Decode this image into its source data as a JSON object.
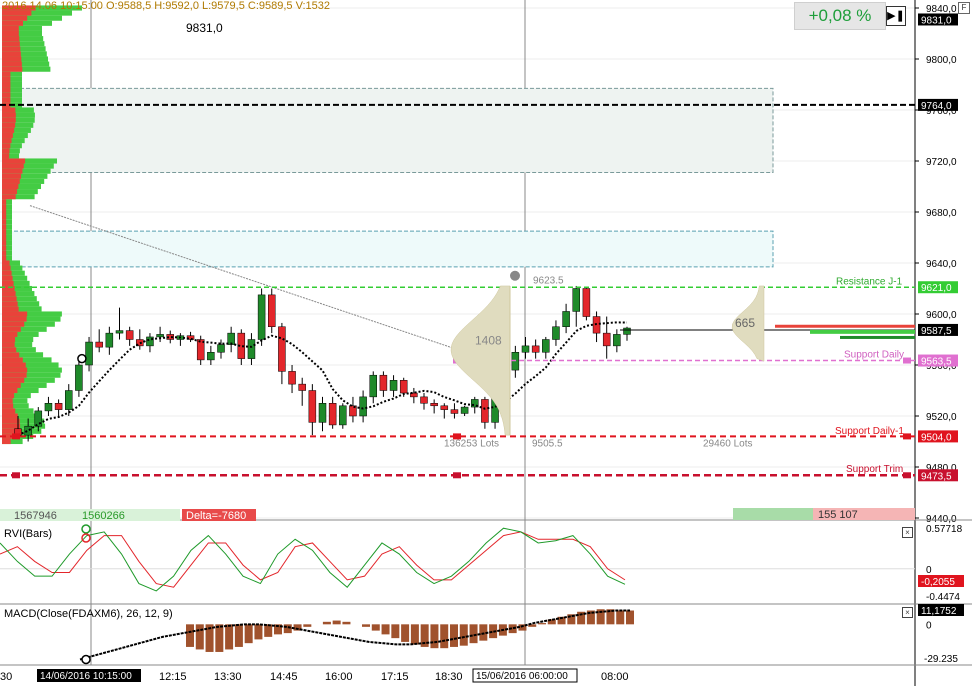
{
  "header": {
    "ohlc": "2016.14.06 10:15:00  O:9588,5  H:9592,0  L:9579,5  C:9589,5  V:1532",
    "change_pct": "+0,08 %",
    "play_icon": "play-to-end-icon",
    "f_label": "F"
  },
  "chart_data": {
    "type": "candlestick",
    "ylim": [
      9440,
      9840
    ],
    "yticks": [
      "9840,0",
      "9800,0",
      "9760,0",
      "9720,0",
      "9680,0",
      "9640,0",
      "9600,0",
      "9560,0",
      "9520,0",
      "9480,0",
      "9440,0"
    ],
    "xticks": [
      "30",
      "12:15",
      "13:30",
      "14:45",
      "16:00",
      "17:15",
      "18:30",
      "08:00"
    ],
    "x_highlight_labels": [
      "14/06/2016 10:15:00",
      "15/06/2016 06:00:00"
    ],
    "candles": [
      [
        9510,
        9520,
        9503,
        9505
      ],
      [
        9505,
        9518,
        9500,
        9512
      ],
      [
        9512,
        9527,
        9508,
        9524
      ],
      [
        9524,
        9535,
        9520,
        9530
      ],
      [
        9530,
        9533,
        9520,
        9525
      ],
      [
        9525,
        9545,
        9520,
        9540
      ],
      [
        9540,
        9565,
        9535,
        9560
      ],
      [
        9560,
        9582,
        9555,
        9578
      ],
      [
        9578,
        9588,
        9570,
        9574
      ],
      [
        9574,
        9590,
        9568,
        9585
      ],
      [
        9585,
        9605,
        9580,
        9587
      ],
      [
        9587,
        9590,
        9575,
        9580
      ],
      [
        9580,
        9588,
        9572,
        9575
      ],
      [
        9575,
        9585,
        9570,
        9582
      ],
      [
        9582,
        9590,
        9578,
        9584
      ],
      [
        9584,
        9587,
        9577,
        9580
      ],
      [
        9580,
        9585,
        9575,
        9583
      ],
      [
        9583,
        9586,
        9578,
        9580
      ],
      [
        9580,
        9583,
        9560,
        9564
      ],
      [
        9564,
        9575,
        9560,
        9570
      ],
      [
        9570,
        9580,
        9565,
        9576
      ],
      [
        9576,
        9590,
        9570,
        9585
      ],
      [
        9585,
        9588,
        9560,
        9565
      ],
      [
        9565,
        9585,
        9560,
        9580
      ],
      [
        9580,
        9620,
        9575,
        9615
      ],
      [
        9615,
        9620,
        9585,
        9590
      ],
      [
        9590,
        9593,
        9545,
        9555
      ],
      [
        9555,
        9560,
        9538,
        9545
      ],
      [
        9545,
        9550,
        9528,
        9540
      ],
      [
        9540,
        9545,
        9505,
        9515
      ],
      [
        9515,
        9535,
        9508,
        9530
      ],
      [
        9530,
        9535,
        9510,
        9513
      ],
      [
        9513,
        9530,
        9510,
        9528
      ],
      [
        9528,
        9535,
        9515,
        9520
      ],
      [
        9520,
        9540,
        9515,
        9535
      ],
      [
        9535,
        9555,
        9530,
        9552
      ],
      [
        9552,
        9555,
        9535,
        9540
      ],
      [
        9540,
        9552,
        9535,
        9548
      ],
      [
        9548,
        9550,
        9535,
        9538
      ],
      [
        9538,
        9542,
        9530,
        9535
      ],
      [
        9535,
        9538,
        9525,
        9530
      ],
      [
        9530,
        9533,
        9522,
        9528
      ],
      [
        9528,
        9530,
        9518,
        9525
      ],
      [
        9525,
        9530,
        9518,
        9522
      ],
      [
        9522,
        9528,
        9520,
        9527
      ],
      [
        9527,
        9535,
        9522,
        9533
      ],
      [
        9533,
        9535,
        9510,
        9515
      ],
      [
        9515,
        9545,
        9510,
        9540
      ],
      [
        9540,
        9560,
        9535,
        9556
      ],
      [
        9556,
        9575,
        9550,
        9570
      ],
      [
        9570,
        9582,
        9565,
        9575
      ],
      [
        9575,
        9580,
        9565,
        9570
      ],
      [
        9570,
        9582,
        9565,
        9580
      ],
      [
        9580,
        9595,
        9575,
        9590
      ],
      [
        9590,
        9608,
        9585,
        9602
      ],
      [
        9602,
        9622,
        9590,
        9620
      ],
      [
        9620,
        9621,
        9595,
        9598
      ],
      [
        9598,
        9602,
        9578,
        9585
      ],
      [
        9585,
        9598,
        9565,
        9575
      ],
      [
        9575,
        9588,
        9570,
        9584
      ],
      [
        9584,
        9590,
        9579,
        9589
      ]
    ],
    "price_labels": {
      "current": "9831,0",
      "box_level": "9764,0",
      "resistance": "9621,0",
      "last": "9587,5",
      "support_daily": "9563,5",
      "support_daily_1": "9504,0",
      "support_trim": "9473,5"
    },
    "hidden_labels": [
      "9831,0",
      "9764,0"
    ],
    "line_labels": {
      "resistance": "Resistance J-1",
      "support_daily": "Support Daily",
      "support_daily_1": "Support Daily-1",
      "support_trim": "Support Trim"
    },
    "profile_labels": {
      "poc1": "1408",
      "lots1": "136253 Lots",
      "high": "9623.5",
      "low": "9505.5",
      "poc2": "665",
      "lots2": "29460 Lots",
      "top_left": "9831,0"
    },
    "footer_labels": {
      "buy": "1567946",
      "sell": "1560266",
      "delta": "Delta=-7680",
      "total": "155 107"
    },
    "rvi": {
      "title": "RVI(Bars)",
      "value": "-0,2055",
      "top": "0.57718",
      "zero": "0",
      "low": "-0.4474",
      "green": [
        0.35,
        0.1,
        -0.1,
        -0.1,
        0.2,
        0.45,
        0.5,
        0.2,
        -0.2,
        -0.3,
        -0.1,
        0.25,
        0.45,
        0.2,
        -0.1,
        -0.2,
        0.2,
        0.4,
        0.25,
        -0.05,
        -0.25,
        0.05,
        0.35,
        0.2,
        -0.05,
        -0.2,
        -0.1,
        0.1,
        0.35,
        0.55,
        0.5,
        0.35,
        0.38,
        0.45,
        0.2,
        -0.1,
        -0.21
      ],
      "red": [
        0.2,
        0.3,
        0.1,
        -0.05,
        -0.05,
        0.25,
        0.45,
        0.45,
        0.1,
        -0.2,
        -0.25,
        0.05,
        0.35,
        0.35,
        0.05,
        -0.15,
        -0.05,
        0.3,
        0.35,
        0.1,
        -0.15,
        -0.1,
        0.2,
        0.3,
        0.05,
        -0.15,
        -0.15,
        0.05,
        0.25,
        0.45,
        0.5,
        0.4,
        0.4,
        0.4,
        0.3,
        0.0,
        -0.15
      ]
    },
    "macd": {
      "title": "MACD(Close(FDAXM6), 26, 12, 9)",
      "value": "11,1752",
      "top_label": "11,1",
      "zero": "0",
      "low": "-29.235",
      "histogram": [
        -18,
        -20,
        -22,
        -22,
        -20,
        -18,
        -15,
        -12,
        -10,
        -8,
        -7,
        -5,
        -2,
        0,
        2,
        3,
        2,
        0,
        -2,
        -5,
        -8,
        -11,
        -14,
        -16,
        -18,
        -19,
        -19,
        -18,
        -17,
        -15,
        -13,
        -11,
        -9,
        -7,
        -5,
        -2,
        1,
        4,
        6,
        8,
        10,
        11,
        12,
        12,
        11,
        11
      ],
      "signal": [
        -28,
        -25,
        -22,
        -19,
        -16,
        -13,
        -10,
        -8,
        -6,
        -4,
        -2,
        -1,
        0,
        0,
        -1,
        -2,
        -4,
        -6,
        -8,
        -10,
        -12,
        -14,
        -15,
        -16,
        -16,
        -15,
        -14,
        -12,
        -10,
        -8,
        -6,
        -4,
        -2,
        1,
        3,
        5,
        7,
        9,
        10,
        11,
        11
      ]
    }
  }
}
